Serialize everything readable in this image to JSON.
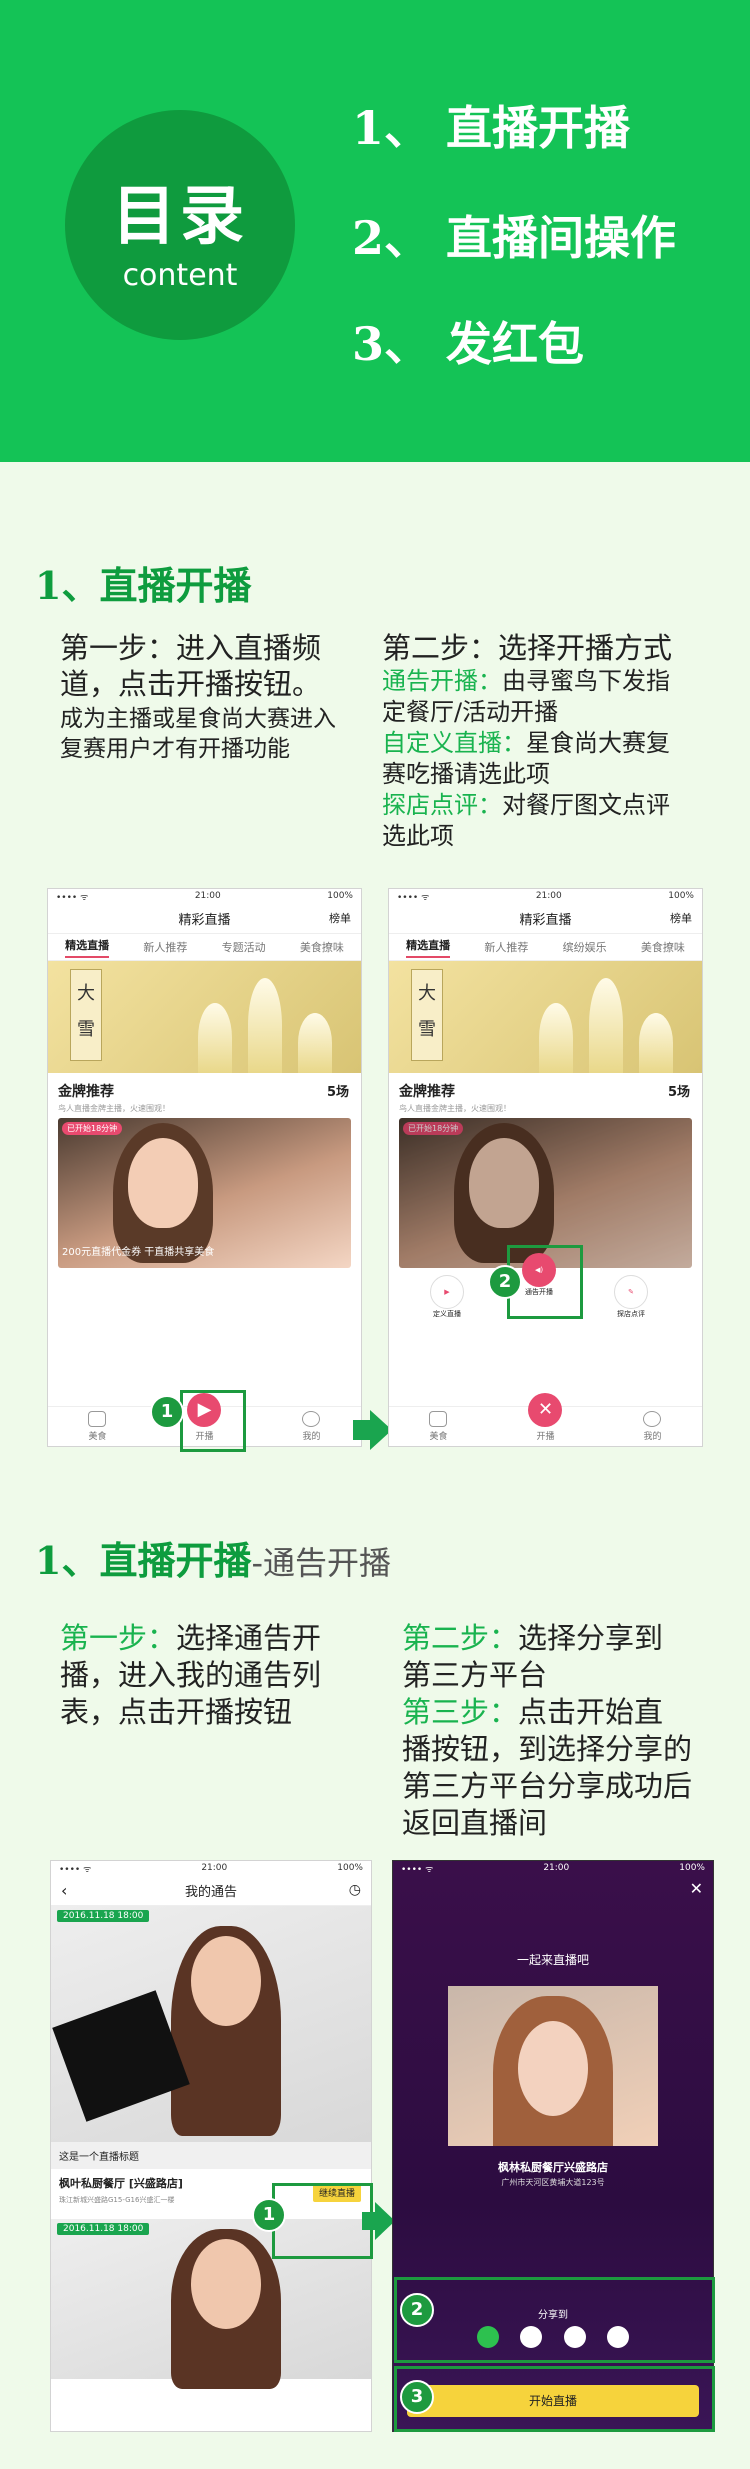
{
  "header": {
    "circle_title": "目录",
    "circle_sub": "content",
    "toc": [
      "1、 直播开播",
      "2、 直播间操作",
      "3、 发红包"
    ]
  },
  "section1": {
    "title": "1、直播开播",
    "step1": {
      "title": "第一步：进入直播频道，点击开播按钮。",
      "desc": "成为主播或星食尚大赛进入复赛用户才有开播功能"
    },
    "step2": {
      "title": "第二步：选择开播方式",
      "o1_label": "通告开播：",
      "o1_desc": "由寻蜜鸟下发指定餐厅/活动开播",
      "o2_label": "自定义直播：",
      "o2_desc": "星食尚大赛复赛吃播请选此项",
      "o3_label": "探店点评：",
      "o3_desc": "对餐厅图文点评选此项"
    }
  },
  "phone_app": {
    "time": "21:00",
    "battery": "100%",
    "signal": "•••• ᯤ",
    "nav_title": "精彩直播",
    "nav_right": "榜单",
    "tabs_a": [
      "精选直播",
      "新人推荐",
      "专题活动",
      "美食撩味"
    ],
    "tabs_b": [
      "精选直播",
      "新人推荐",
      "缤纷娱乐",
      "美食撩味"
    ],
    "banner_text": "大雪",
    "gold_title": "金牌推荐",
    "gold_count": "5场",
    "gold_sub": "鸟人直播金牌主播，火速围观！",
    "live_tag": "已开始18分钟",
    "caption": "200元直播代金券 干直播共享美食",
    "bottom": [
      "美食",
      "开播",
      "我的"
    ],
    "popup": [
      "定义直播",
      "通告开播",
      "探店点评"
    ]
  },
  "section2": {
    "title": "1、直播开播",
    "title_suffix": "-通告开播",
    "left_label": "第一步：",
    "left_desc": "选择通告开播，进入我的通告列表，点击开播按钮",
    "r2_label": "第二步：",
    "r2_desc": "选择分享到第三方平台",
    "r3_label": "第三步：",
    "r3_desc": "点击开始直播按钮，到选择分享的第三方平台分享成功后返回直播间"
  },
  "notice_phone": {
    "time": "21:00",
    "battery": "100%",
    "title": "我的通告",
    "date": "2016.11.18  18:00",
    "live_title": "这是一个直播标题",
    "restaurant": "枫叶私厨餐厅 [兴盛路店]",
    "address": "珠江新城兴盛路G15-G16兴盛汇一楼",
    "continue_btn": "继续直播"
  },
  "share_phone": {
    "time": "21:00",
    "battery": "100%",
    "title": "一起来直播吧",
    "restaurant": "枫林私厨餐厅兴盛路店",
    "address": "广州市天河区黄埔大道123号",
    "share_label": "分享到",
    "start_btn": "开始直播"
  },
  "markers": [
    "1",
    "2",
    "3"
  ]
}
